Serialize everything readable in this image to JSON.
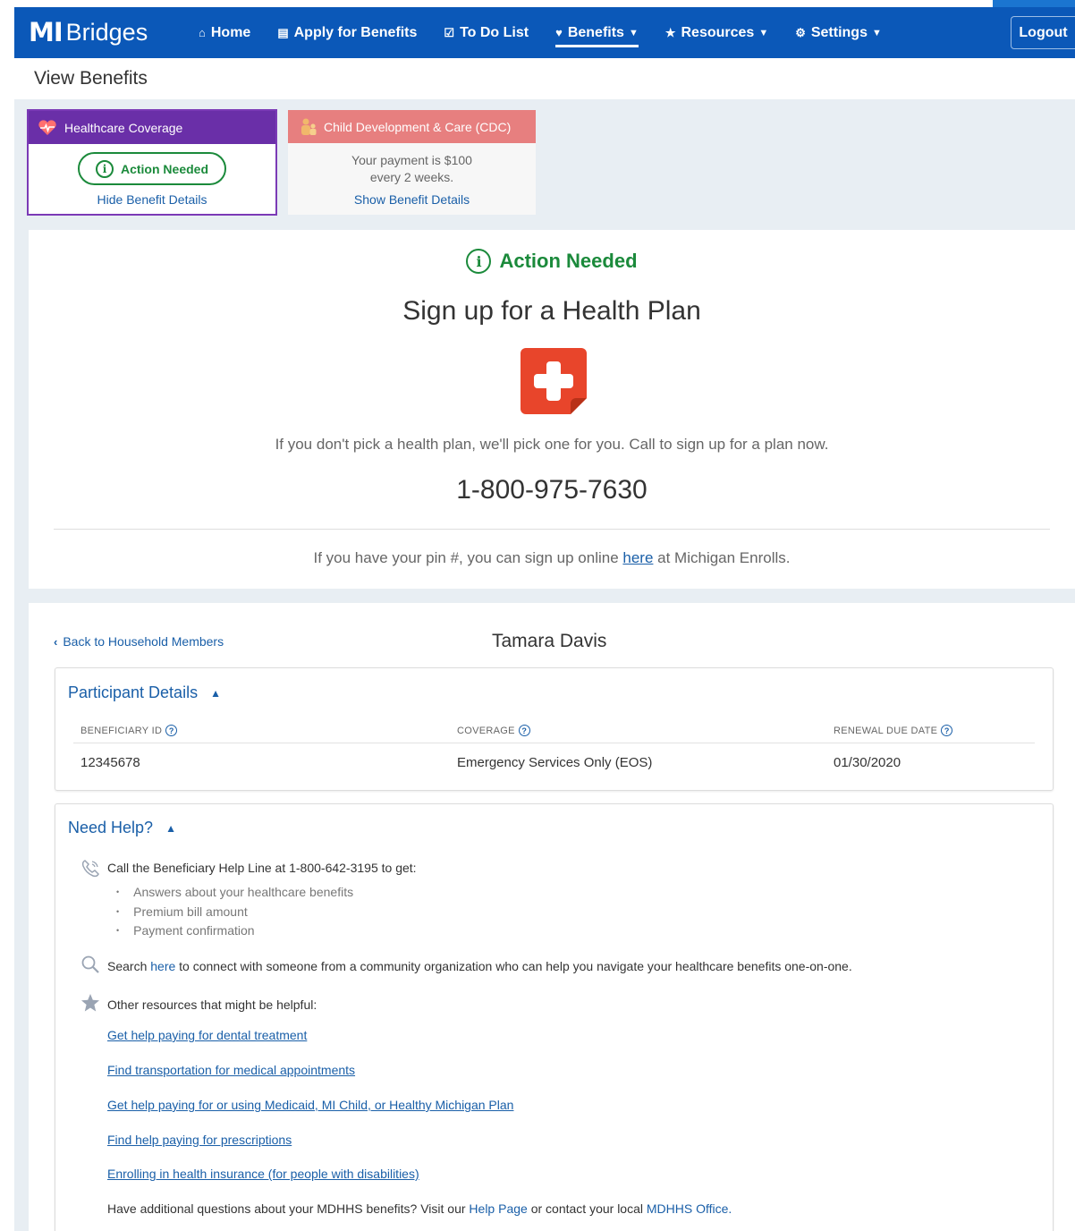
{
  "header": {
    "logo_mi": "MI",
    "logo_text": "Bridges",
    "nav": [
      {
        "label": "Home",
        "icon": "home-icon"
      },
      {
        "label": "Apply for Benefits",
        "icon": "document-icon"
      },
      {
        "label": "To Do List",
        "icon": "checkbox-icon"
      },
      {
        "label": "Benefits",
        "icon": "heart-icon",
        "active": true
      },
      {
        "label": "Resources",
        "icon": "star-icon"
      },
      {
        "label": "Settings",
        "icon": "gear-icon"
      }
    ],
    "logout": "Logout",
    "color": "#0b58b8"
  },
  "page": {
    "title": "View Benefits"
  },
  "cards": {
    "health": {
      "title": "Healthcare Coverage",
      "status": "Action Needed",
      "link": "Hide Benefit Details",
      "color": "#6a2fa8"
    },
    "cdc": {
      "title": "Child Development & Care (CDC)",
      "line1": "Your payment is $100",
      "line2": "every 2 weeks.",
      "link": "Show Benefit Details",
      "color": "#e77f7f"
    }
  },
  "action": {
    "status": "Action Needed",
    "title": "Sign up for a Health Plan",
    "icon": "medical-cross-icon",
    "pick_text": "If you don't pick a health plan, we'll pick one for you. Call to sign up for a plan now.",
    "phone": "1-800-975-7630",
    "pin_before": "If you have your pin #, you can sign up online ",
    "pin_link": "here",
    "pin_after": " at Michigan Enrolls.",
    "status_color": "#1b8a3b"
  },
  "details": {
    "back": "Back to Household Members",
    "member_name": "Tamara Davis",
    "participant": {
      "heading": "Participant Details",
      "columns": [
        {
          "label": "BENEFICIARY ID",
          "value": "12345678"
        },
        {
          "label": "COVERAGE",
          "value": "Emergency Services Only (EOS)"
        },
        {
          "label": "RENEWAL DUE DATE",
          "value": "01/30/2020"
        }
      ]
    },
    "help": {
      "heading": "Need Help?",
      "call_text": "Call the Beneficiary Help Line at 1-800-642-3195 to get:",
      "bullets": [
        "Answers about your healthcare benefits",
        "Premium bill amount",
        "Payment confirmation"
      ],
      "search_before": "Search ",
      "search_link": "here",
      "search_after": " to connect with someone from a community organization who can help you navigate your healthcare benefits one-on-one.",
      "resources_text": "Other resources that might be helpful:",
      "links": [
        "Get help paying for dental treatment",
        "Find transportation for medical appointments",
        "Get help paying for or using Medicaid, MI Child, or Healthy Michigan Plan",
        "Find help paying for prescriptions",
        "Enrolling in health insurance (for people with disabilities)"
      ],
      "footer_before": "Have additional questions about your MDHHS benefits? Visit our ",
      "footer_link1": "Help Page",
      "footer_mid": " or contact your local ",
      "footer_link2": "MDHHS Office."
    }
  }
}
